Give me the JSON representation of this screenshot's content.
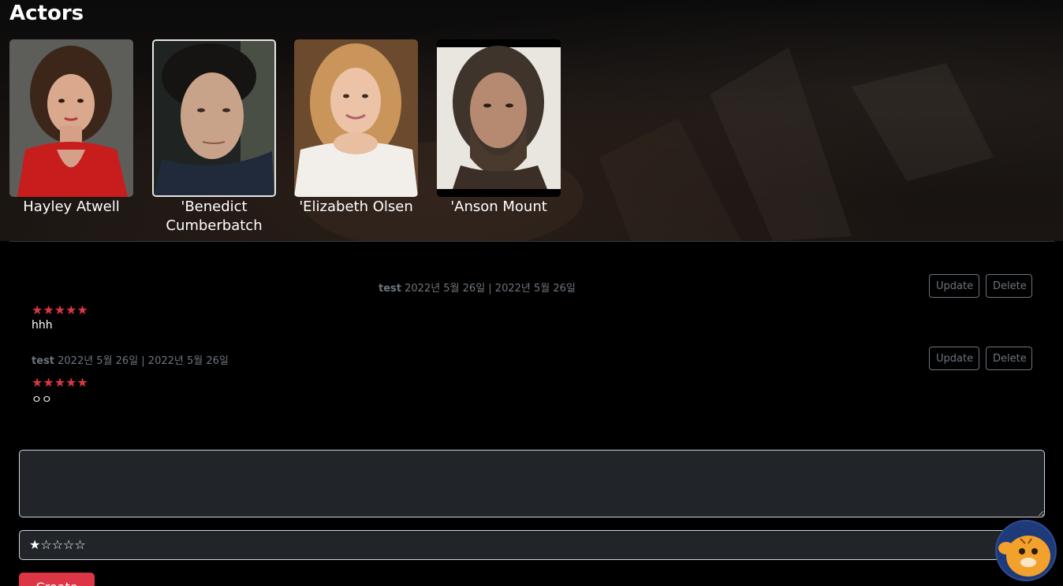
{
  "section_title": "Actors",
  "actors": [
    {
      "name": "Hayley Atwell"
    },
    {
      "name": "'Benedict Cumberbatch"
    },
    {
      "name": "'Elizabeth Olsen"
    },
    {
      "name": "'Anson Mount"
    }
  ],
  "reviews": [
    {
      "author": "test",
      "dates": "2022년 5월 26일 | 2022년 5월 26일",
      "stars": "★★★★★",
      "body": "hhh",
      "update_label": "Update",
      "delete_label": "Delete"
    },
    {
      "author": "test",
      "dates": "2022년 5월 26일 | 2022년 5월 26일",
      "stars": "★★★★★",
      "body": "ㅇㅇ",
      "update_label": "Update",
      "delete_label": "Delete"
    }
  ],
  "form": {
    "comment_value": "",
    "rating_value": "★☆☆☆☆",
    "submit_label": "Create"
  },
  "colors": {
    "accent": "#dc3545",
    "muted": "#6c757d",
    "field_bg": "#212529"
  }
}
